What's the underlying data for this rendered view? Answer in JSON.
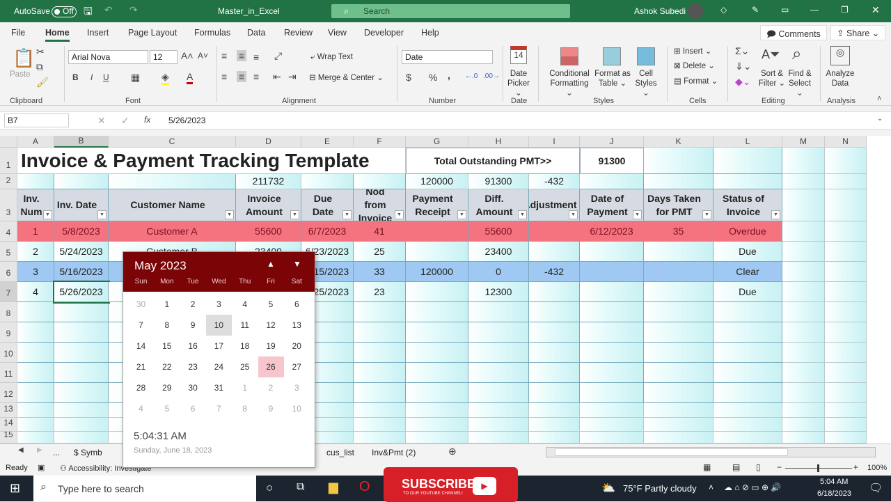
{
  "titlebar": {
    "autosave": "AutoSave",
    "autosave_state": "Off",
    "filename": "Master_in_Excel",
    "search_placeholder": "Search",
    "user": "Ashok Subedi"
  },
  "tabs": [
    "File",
    "Home",
    "Insert",
    "Page Layout",
    "Formulas",
    "Data",
    "Review",
    "View",
    "Developer",
    "Help"
  ],
  "active_tab": "Home",
  "comments_label": "Comments",
  "share_label": "Share",
  "ribbon": {
    "clipboard": {
      "paste": "Paste",
      "group": "Clipboard"
    },
    "font": {
      "name": "Arial Nova",
      "size": "12",
      "bold": "B",
      "italic": "I",
      "underline": "U",
      "group": "Font"
    },
    "alignment": {
      "wrap": "Wrap Text",
      "merge": "Merge & Center",
      "group": "Alignment"
    },
    "number": {
      "format": "Date",
      "currency": "$",
      "percent": "%",
      "comma": ",",
      "group": "Number"
    },
    "date": {
      "picker_line1": "Date",
      "picker_line2": "Picker",
      "day_icon": "14",
      "group": "Date"
    },
    "styles": {
      "cond1": "Conditional",
      "cond2": "Formatting",
      "fmt1": "Format as",
      "fmt2": "Table",
      "cell1": "Cell",
      "cell2": "Styles",
      "group": "Styles"
    },
    "cells": {
      "insert": "Insert",
      "delete": "Delete",
      "format": "Format",
      "group": "Cells"
    },
    "editing": {
      "sort1": "Sort &",
      "sort2": "Filter",
      "find1": "Find &",
      "find2": "Select",
      "group": "Editing"
    },
    "analysis": {
      "a1": "Analyze",
      "a2": "Data",
      "group": "Analysis"
    }
  },
  "formula_bar": {
    "name_box": "B7",
    "fx": "fx",
    "value": "5/26/2023"
  },
  "columns": [
    "A",
    "B",
    "C",
    "D",
    "E",
    "F",
    "G",
    "H",
    "I",
    "J",
    "K",
    "L",
    "M",
    "N"
  ],
  "sheet": {
    "title": "Invoice & Payment Tracking Template",
    "total_label": "Total Outstanding PMT>>",
    "total_value": "91300",
    "row2": {
      "D": "211732",
      "G": "120000",
      "H": "91300",
      "I": "-432"
    },
    "headers": [
      "Inv. Num",
      "Inv. Date",
      "Customer Name",
      "Invoice Amount",
      "Due Date",
      "Nod from Invoice",
      "Payment Receipt",
      "Diff. Amount",
      "Adjustment",
      "Date of Payment",
      "Days Taken for PMT",
      "Status of Invoice"
    ],
    "rows": [
      [
        "1",
        "5/8/2023",
        "Customer A",
        "55600",
        "6/7/2023",
        "41",
        "",
        "55600",
        "",
        "6/12/2023",
        "35",
        "Overdue"
      ],
      [
        "2",
        "5/24/2023",
        "Customer B",
        "23400",
        "6/23/2023",
        "25",
        "",
        "23400",
        "",
        "",
        "",
        "Due"
      ],
      [
        "3",
        "5/16/2023",
        "",
        "",
        "6/15/2023",
        "33",
        "120000",
        "0",
        "-432",
        "",
        "",
        "Clear"
      ],
      [
        "4",
        "5/26/2023",
        "",
        "",
        "6/25/2023",
        "23",
        "",
        "12300",
        "",
        "",
        "",
        "Due"
      ]
    ],
    "row_numbers": [
      "1",
      "2",
      "3",
      "4",
      "5",
      "6",
      "7",
      "8",
      "9",
      "10",
      "11",
      "12",
      "13",
      "14",
      "15"
    ]
  },
  "colors": {
    "overdue_row": "#f4737f",
    "clear_row": "#9fc8f2",
    "header_row": "#d6dbe3",
    "calendar_header": "#7a0406",
    "accent": "#217346",
    "selected_day": "#f6c6cc"
  },
  "calendar": {
    "month_year": "May  2023",
    "weekdays": [
      "Sun",
      "Mon",
      "Tue",
      "Wed",
      "Thu",
      "Fri",
      "Sat"
    ],
    "days": [
      "30",
      "1",
      "2",
      "3",
      "4",
      "5",
      "6",
      "7",
      "8",
      "9",
      "10",
      "11",
      "12",
      "13",
      "14",
      "15",
      "16",
      "17",
      "18",
      "19",
      "20",
      "21",
      "22",
      "23",
      "24",
      "25",
      "26",
      "27",
      "28",
      "29",
      "30",
      "31",
      "1",
      "2",
      "3",
      "4",
      "5",
      "6",
      "7",
      "8",
      "9",
      "10"
    ],
    "selected": "26",
    "hovered": "10",
    "time": "5:04:31 AM",
    "date": "Sunday, June 18, 2023"
  },
  "sheet_tabs": [
    "...",
    "$ Symb",
    "cus_list",
    "Inv&Pmt (2)"
  ],
  "status": {
    "ready": "Ready",
    "accessibility": "Accessibility: Investigate",
    "zoom": "100%"
  },
  "taskbar": {
    "search_placeholder": "Type here to search",
    "subscribe": "SUBSCRIBE",
    "subscribe_sub": "TO OUR YOUTUBE CHANNEL!",
    "weather": "75°F  Partly cloudy",
    "time": "5:04 AM",
    "date": "6/18/2023"
  }
}
